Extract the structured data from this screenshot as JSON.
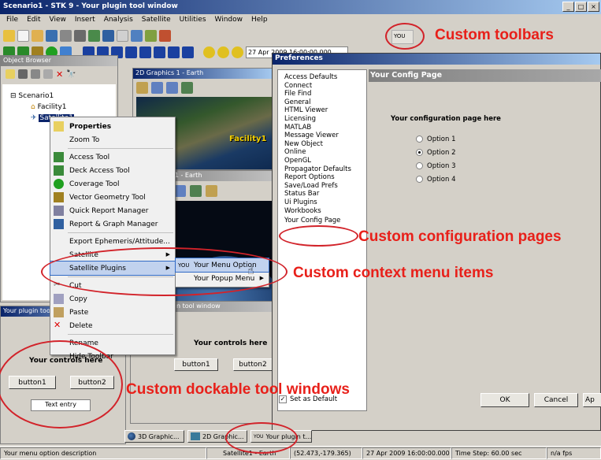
{
  "window": {
    "title": "Scenario1 - STK 9 - Your plugin tool window",
    "controls": [
      "_",
      "□",
      "×"
    ]
  },
  "menu": [
    "File",
    "Edit",
    "View",
    "Insert",
    "Analysis",
    "Satellite",
    "Utilities",
    "Window",
    "Help"
  ],
  "toolbar": {
    "date": "27 Apr 2009 16:00:00.000",
    "custom_button": "YOU"
  },
  "object_browser": {
    "title": "Object Browser",
    "items": [
      "Scenario1",
      "Facility1",
      "Satellite1"
    ]
  },
  "graphics_2d_top": {
    "title": "2D Graphics 1 - Earth",
    "facility_label": "Facility1"
  },
  "graphics_2d_bottom": {
    "title": "Graphics 1 - Earth"
  },
  "context_menu": {
    "items": [
      "Properties",
      "Zoom To",
      "Access Tool",
      "Deck Access Tool",
      "Coverage Tool",
      "Vector Geometry Tool",
      "Quick Report Manager",
      "Report & Graph Manager",
      "Export Ephemeris/Attitude...",
      "Satellite",
      "Satellite Plugins",
      "Cut",
      "Copy",
      "Paste",
      "Delete",
      "Rename",
      "Hide Toolbar"
    ]
  },
  "submenu": {
    "items": [
      "Your Menu Option",
      "Your Popup Menu"
    ],
    "icon_text": "YOU"
  },
  "preferences": {
    "title": "Preferences",
    "tree": [
      "Access Defaults",
      "Connect",
      "File Find",
      "General",
      "HTML Viewer",
      "Licensing",
      "MATLAB",
      "Message Viewer",
      "New Object",
      "Online",
      "OpenGL",
      "Propagator Defaults",
      "Report Options",
      "Save/Load Prefs",
      "Status Bar",
      "Ui Plugins",
      "Workbooks",
      "Your Config Page"
    ],
    "page_title": "Your Config Page",
    "page_text": "Your configuration page here",
    "options": [
      "Option 1",
      "Option 2",
      "Option 3",
      "Option 4"
    ],
    "selected_option": "Option 2",
    "set_default": "Set as Default",
    "ok": "OK",
    "cancel": "Cancel",
    "apply": "Ap"
  },
  "tool_window": {
    "title": "Your plugin tool w",
    "controls_text": "Your controls here",
    "button1": "button1",
    "button2": "button2",
    "entry": "Text entry"
  },
  "tool_window_docked": {
    "title": "n tool window",
    "controls_text": "Your controls here",
    "button1": "button1",
    "button2": "button2"
  },
  "tasks": [
    "3D Graphic...",
    "2D Graphic...",
    "Your plugin t..."
  ],
  "task_you": "YOU",
  "status": {
    "message": "Your menu option description",
    "object": "Satellite1 - Earth",
    "coords": "(52.473,-179.365)",
    "time": "27 Apr 2009 16:00:00.000",
    "step": "Time Step: 60.00 sec",
    "fps": "n/a fps"
  },
  "callouts": {
    "toolbars": "Custom toolbars",
    "config": "Custom configuration pages",
    "context": "Custom context menu items",
    "dockable": "Custom dockable tool windows"
  },
  "colors": {
    "callout": "#e8201a",
    "titlebar": "#0a246a",
    "highlight": "#c1d2ee"
  }
}
